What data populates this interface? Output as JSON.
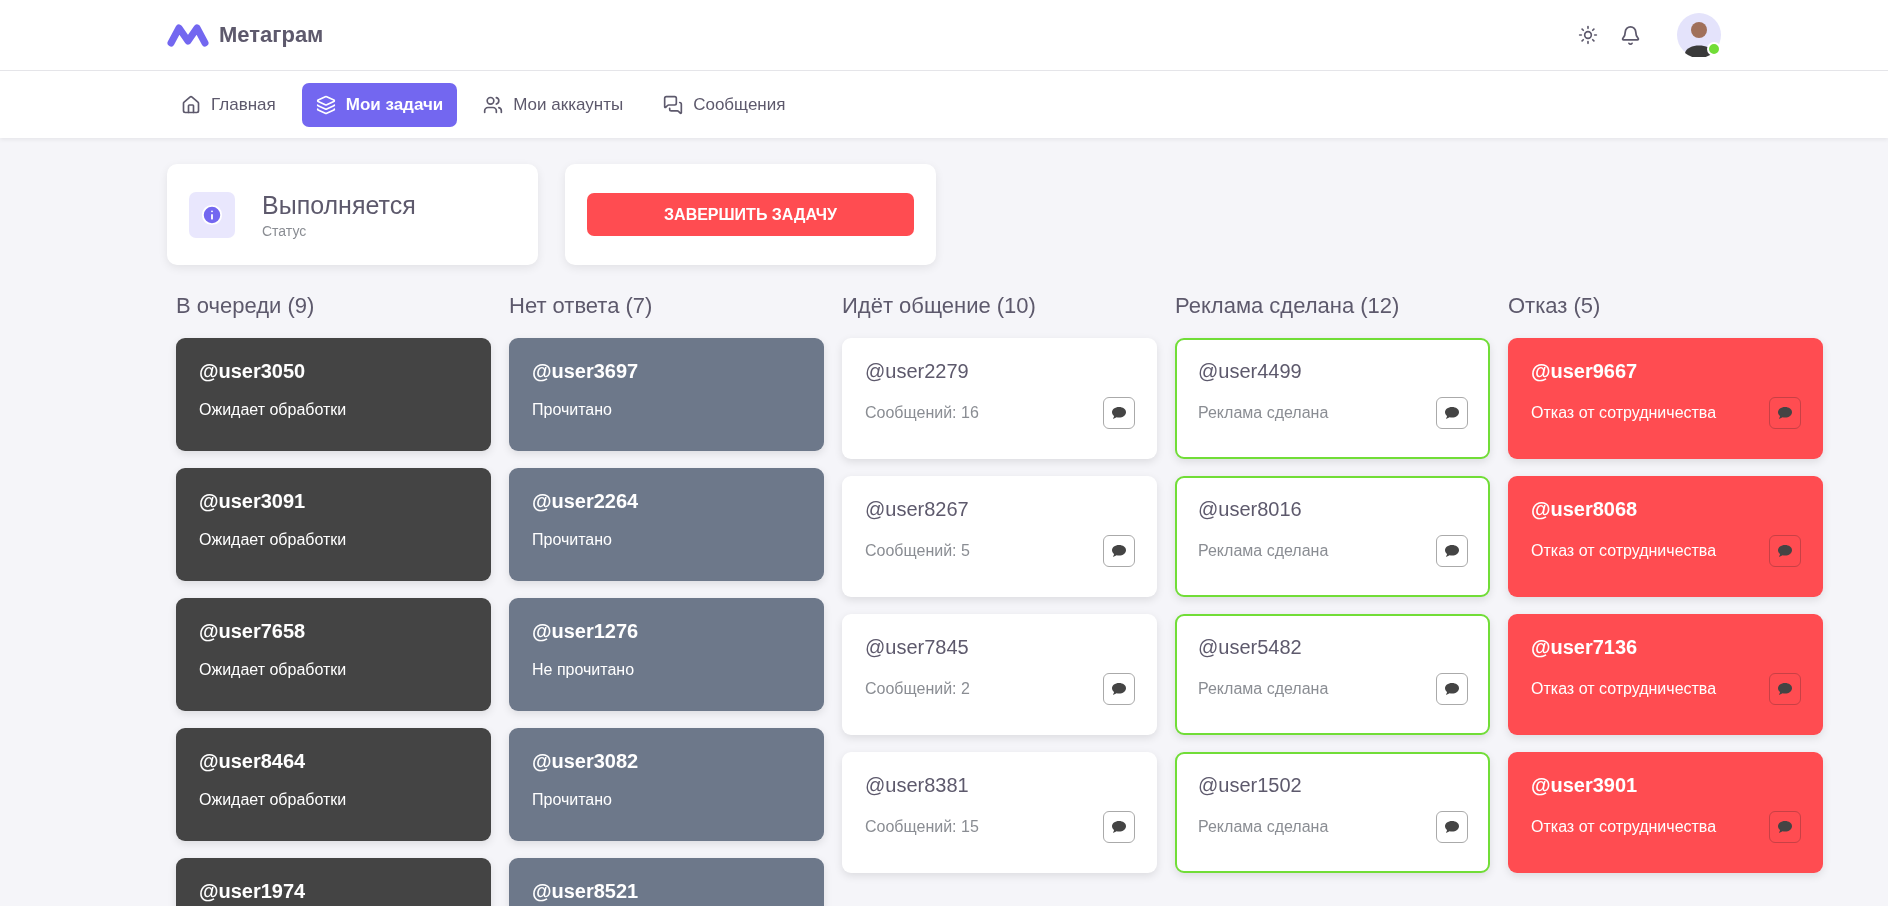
{
  "brand": {
    "name": "Метаграм"
  },
  "nav": [
    {
      "label": "Главная",
      "selected": false
    },
    {
      "label": "Мои задачи",
      "selected": true
    },
    {
      "label": "Мои аккаунты",
      "selected": false
    },
    {
      "label": "Сообщения",
      "selected": false
    }
  ],
  "user": {
    "online": true
  },
  "status": {
    "value": "Выполняется",
    "label": "Статус"
  },
  "action": {
    "label": "ЗАВЕРШИТЬ ЗАДАЧУ"
  },
  "columns": [
    {
      "title": "В очереди (9)",
      "kind": "dark",
      "cards": [
        {
          "user": "@user3050",
          "text": "Ожидает обработки"
        },
        {
          "user": "@user3091",
          "text": "Ожидает обработки"
        },
        {
          "user": "@user7658",
          "text": "Ожидает обработки"
        },
        {
          "user": "@user8464",
          "text": "Ожидает обработки"
        },
        {
          "user": "@user1974"
        }
      ]
    },
    {
      "title": "Нет ответа (7)",
      "kind": "gray",
      "cards": [
        {
          "user": "@user3697",
          "text": "Прочитано"
        },
        {
          "user": "@user2264",
          "text": "Прочитано"
        },
        {
          "user": "@user1276",
          "text": "Не прочитано"
        },
        {
          "user": "@user3082",
          "text": "Прочитано"
        },
        {
          "user": "@user8521"
        }
      ]
    },
    {
      "title": "Идёт общение (10)",
      "kind": "white",
      "cards": [
        {
          "user": "@user2279",
          "text": "Сообщений: 16"
        },
        {
          "user": "@user8267",
          "text": "Сообщений: 5"
        },
        {
          "user": "@user7845",
          "text": "Сообщений: 2"
        },
        {
          "user": "@user8381",
          "text": "Сообщений: 15"
        }
      ]
    },
    {
      "title": "Реклама сделана (12)",
      "kind": "outlined",
      "cards": [
        {
          "user": "@user4499",
          "text": "Реклама сделана"
        },
        {
          "user": "@user8016",
          "text": "Реклама сделана"
        },
        {
          "user": "@user5482",
          "text": "Реклама сделана"
        },
        {
          "user": "@user1502",
          "text": "Реклама сделана"
        }
      ]
    },
    {
      "title": "Отказ (5)",
      "kind": "red",
      "cards": [
        {
          "user": "@user9667",
          "text": "Отказ от сотрудничества"
        },
        {
          "user": "@user8068",
          "text": "Отказ от сотрудничества"
        },
        {
          "user": "@user7136",
          "text": "Отказ от сотрудничества"
        },
        {
          "user": "@user3901",
          "text": "Отказ от сотрудничества"
        }
      ]
    }
  ]
}
